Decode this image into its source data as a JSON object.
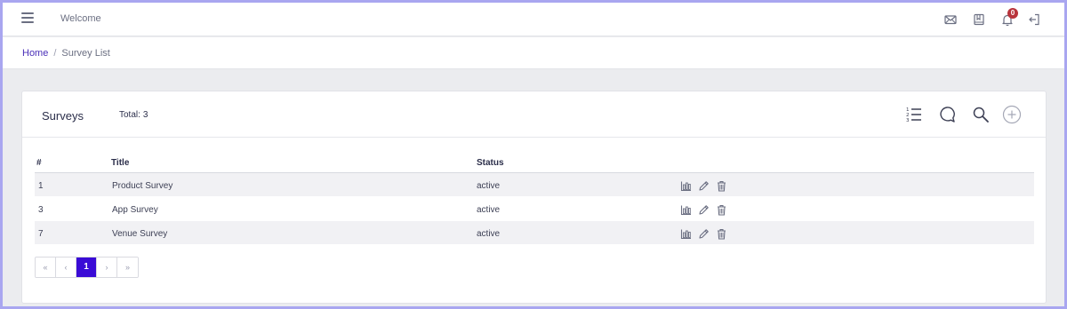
{
  "topbar": {
    "welcome": "Welcome",
    "notifications_count": "0",
    "icons": [
      "mail-icon",
      "bookmark-icon",
      "bell-icon",
      "logout-icon"
    ]
  },
  "breadcrumb": {
    "home": "Home",
    "separator": "/",
    "current": "Survey List"
  },
  "card": {
    "title": "Surveys",
    "total_label": "Total:",
    "total_value": "3",
    "header_icons": [
      "ordered-list-icon",
      "comment-icon",
      "search-icon",
      "add-circle-icon"
    ]
  },
  "table": {
    "columns": [
      "#",
      "Title",
      "Status",
      ""
    ],
    "rows": [
      {
        "id": "1",
        "title": "Product Survey",
        "status": "active"
      },
      {
        "id": "3",
        "title": "App Survey",
        "status": "active"
      },
      {
        "id": "7",
        "title": "Venue Survey",
        "status": "active"
      }
    ],
    "row_actions": [
      "chart-icon",
      "edit-icon",
      "delete-icon"
    ]
  },
  "pagination": {
    "first": "«",
    "prev": "‹",
    "current": "1",
    "next": "›",
    "last": "»"
  },
  "colors": {
    "accent": "#3a0bd6",
    "link": "#4a2fb8",
    "badge": "#b8343c",
    "frame": "#a9a6f0"
  }
}
